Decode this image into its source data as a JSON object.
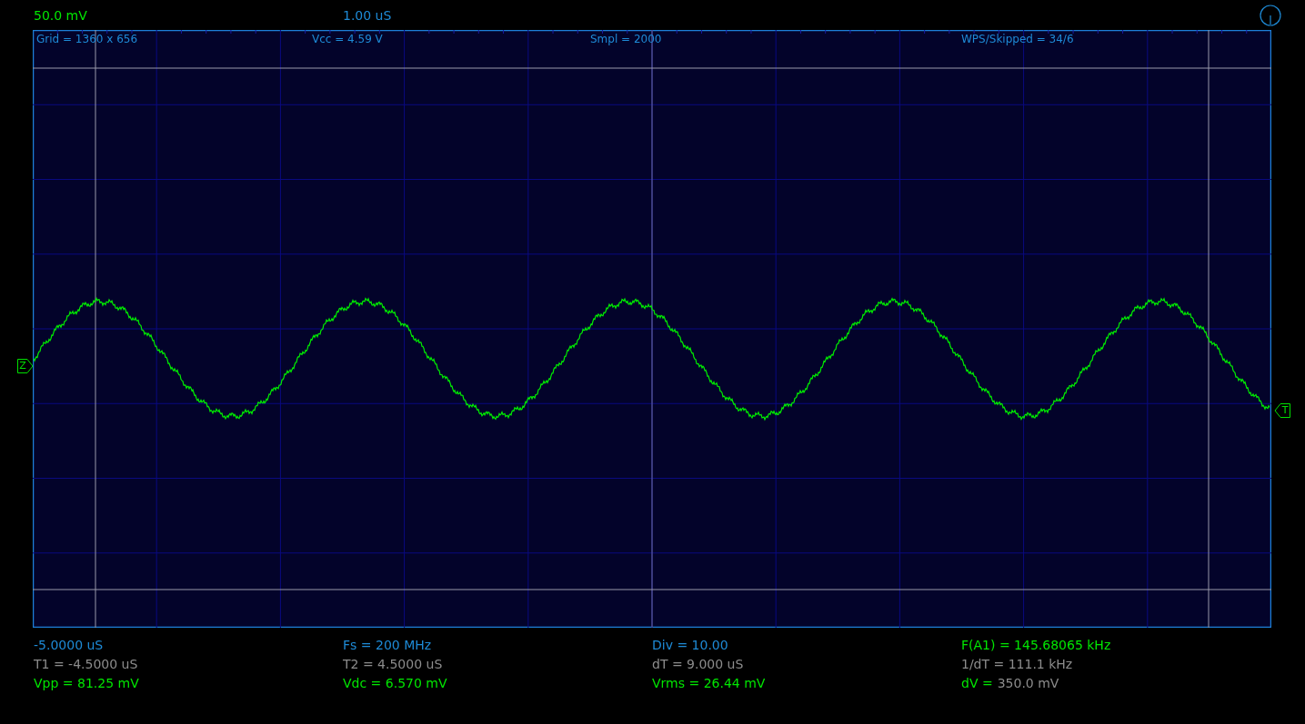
{
  "header": {
    "volts_per_div": "50.0 mV",
    "time_per_div": "1.00 uS"
  },
  "plot_info": [
    "Grid = 1360 x 656",
    "Vcc = 4.59 V",
    "Smpl = 2000",
    "WPS/Skipped  = 34/6"
  ],
  "markers": [
    {
      "kind": "ground",
      "label": "Z"
    },
    {
      "kind": "trigger",
      "label": "T"
    }
  ],
  "readouts": [
    {
      "kind": "setting",
      "text": "-5.0000 uS"
    },
    {
      "kind": "setting",
      "text": "Fs = 200 MHz"
    },
    {
      "kind": "setting",
      "text": "Div = 10.00"
    },
    {
      "kind": "measure",
      "text": "F(A1) = 145.68065 kHz"
    },
    {
      "kind": "cursor",
      "text": "T1 = -4.5000 uS"
    },
    {
      "kind": "cursor",
      "text": "T2 = 4.5000 uS"
    },
    {
      "kind": "cursor",
      "text": "dT = 9.000 uS"
    },
    {
      "kind": "cursor",
      "text": "1/dT = 111.1 kHz"
    },
    {
      "kind": "measure",
      "text": "Vpp = 81.25 mV"
    },
    {
      "kind": "measure",
      "text": "Vdc = 6.570 mV"
    },
    {
      "kind": "measure",
      "text": "Vrms = 26.44 mV"
    },
    {
      "kind": "split",
      "label": "dV =",
      "value": "350.0 mV"
    }
  ]
}
